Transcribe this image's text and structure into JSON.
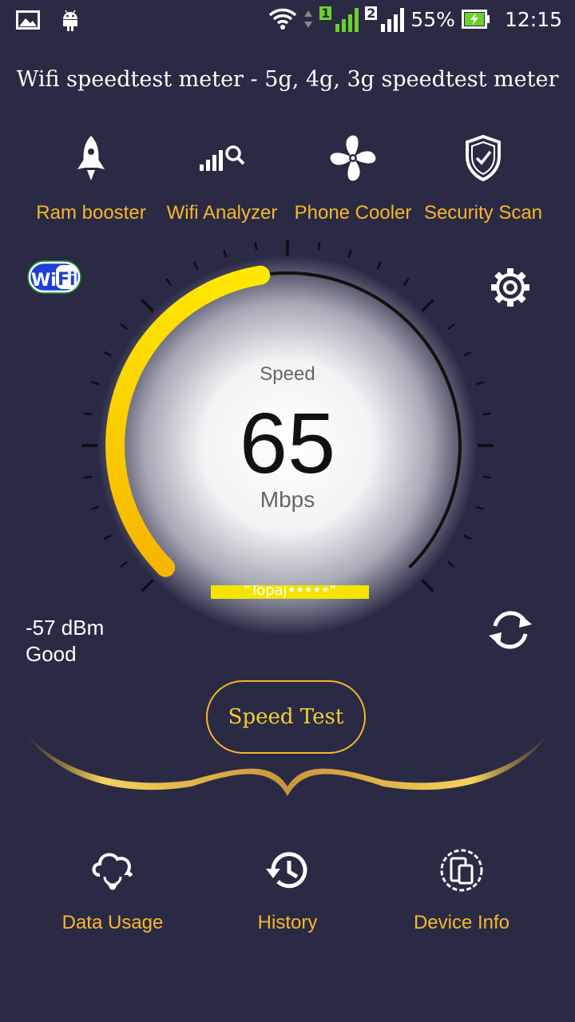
{
  "status_bar": {
    "sim1": "1",
    "sim2": "2",
    "battery": "55%",
    "time": "12:15"
  },
  "app_title": "Wifi speedtest meter - 5g, 4g, 3g speedtest meter",
  "tools": [
    {
      "label": "Ram booster",
      "icon": "rocket-icon"
    },
    {
      "label": "Wifi Analyzer",
      "icon": "signal-search-icon"
    },
    {
      "label": "Phone Cooler",
      "icon": "fan-icon"
    },
    {
      "label": "Security Scan",
      "icon": "shield-check-icon"
    }
  ],
  "wifi_badge": "WiFi",
  "gauge": {
    "label": "Speed",
    "value": "65",
    "unit": "Mbps",
    "ssid": "\"Topaj•••••\""
  },
  "signal": {
    "strength": "-57 dBm",
    "quality": "Good"
  },
  "speed_test_button": "Speed Test",
  "bottom_nav": [
    {
      "label": "Data Usage",
      "icon": "cloud-data-icon"
    },
    {
      "label": "History",
      "icon": "history-icon"
    },
    {
      "label": "Device Info",
      "icon": "device-info-icon"
    }
  ],
  "colors": {
    "background": "#2b2a45",
    "accent": "#f5b82a",
    "gauge_arc": "#f5d800"
  }
}
